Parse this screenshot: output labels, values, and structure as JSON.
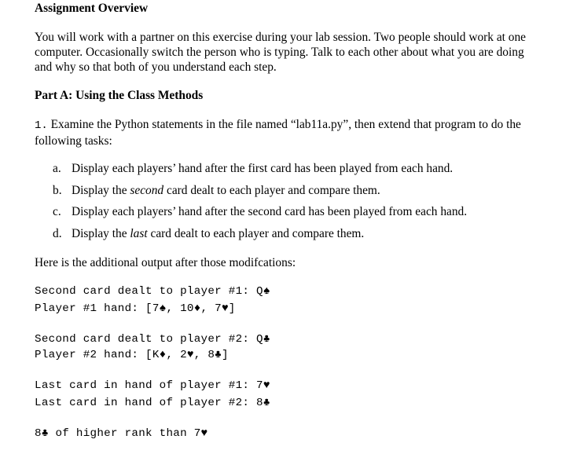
{
  "document": {
    "title": "Assignment Overview",
    "intro_lines": [
      "You will work with a partner on this exercise during your lab session.  Two people should work at one",
      "computer.  Occasionally switch the person who is typing.  Talk to each other about what you are doing",
      "and why so that both of you understand each step."
    ],
    "part_a_heading": "Part A:  Using the Class Methods",
    "step1": {
      "number": "1.",
      "lines": [
        " Examine the Python statements in the file named “lab11a.py”, then extend that program to do the",
        "following tasks:"
      ]
    },
    "tasks": [
      {
        "marker": "a.",
        "before": "Display each players’ hand after the first card has been played from each hand.",
        "emph": "",
        "after": ""
      },
      {
        "marker": "b.",
        "before": "Display the ",
        "emph": "second",
        "after": " card dealt to each player and compare them."
      },
      {
        "marker": "c.",
        "before": "Display each players’ hand after the second card has been played from each hand.",
        "emph": "",
        "after": ""
      },
      {
        "marker": "d.",
        "before": "Display the ",
        "emph": "last",
        "after": " card dealt to each player and compare them."
      }
    ],
    "output_intro": "Here is the additional output after those modifcations:",
    "output_lines": [
      "Second card dealt to player #1: Q♠",
      "Player #1 hand: [7♠, 10♦, 7♥]",
      "Second card dealt to player #2: Q♣",
      "Player #2 hand: [K♦, 2♥, 8♣]",
      "Last card in hand of player #1: 7♥",
      "Last card in hand of player #2: 8♣",
      "8♣ of higher rank than 7♥"
    ]
  }
}
